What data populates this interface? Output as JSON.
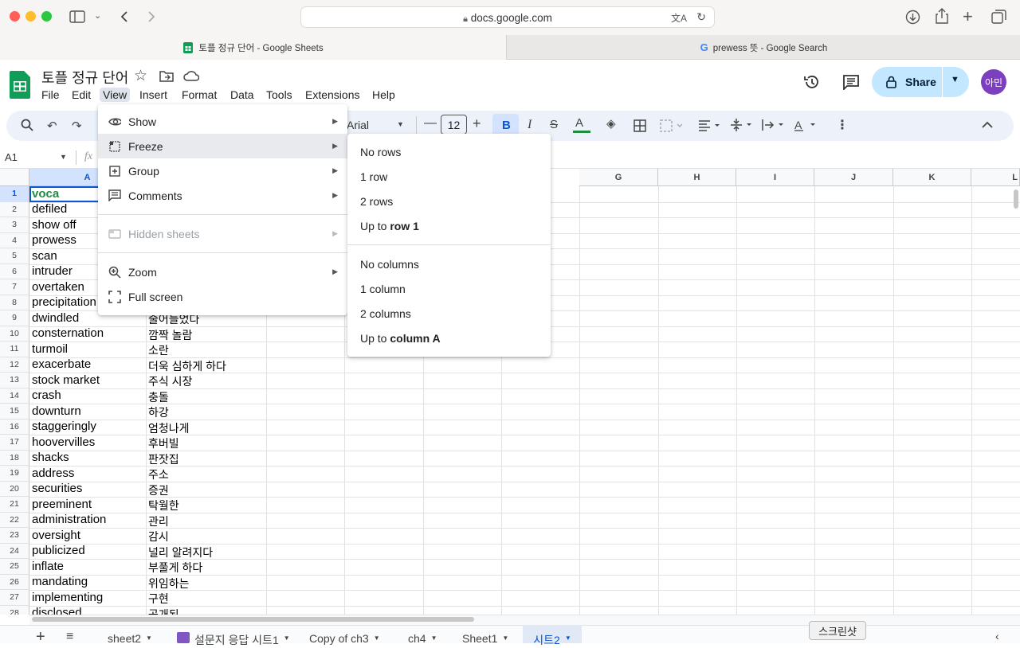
{
  "browser": {
    "url": "docs.google.com",
    "tabs": [
      {
        "title": "토플 정규 단어 - Google Sheets"
      },
      {
        "title": "prewess 뜻 - Google Search"
      }
    ]
  },
  "doc": {
    "title": "토플 정규 단어",
    "menus": [
      "File",
      "Edit",
      "View",
      "Insert",
      "Format",
      "Data",
      "Tools",
      "Extensions",
      "Help"
    ],
    "share_label": "Share",
    "avatar": "아민"
  },
  "toolbar": {
    "font": "Arial",
    "font_size": "12",
    "bold": "B",
    "italic": "I"
  },
  "formula": {
    "cell_ref": "A1",
    "fx": "fx"
  },
  "grid": {
    "columns": [
      "A",
      "G",
      "H",
      "I",
      "J",
      "K",
      "L"
    ],
    "rows": [
      {
        "n": "1",
        "a": "voca",
        "b": ""
      },
      {
        "n": "2",
        "a": "defiled",
        "b": ""
      },
      {
        "n": "3",
        "a": "show off",
        "b": ""
      },
      {
        "n": "4",
        "a": "prowess",
        "b": ""
      },
      {
        "n": "5",
        "a": "scan",
        "b": ""
      },
      {
        "n": "6",
        "a": "intruder",
        "b": ""
      },
      {
        "n": "7",
        "a": "overtaken",
        "b": ""
      },
      {
        "n": "8",
        "a": "precipitation",
        "b": ""
      },
      {
        "n": "9",
        "a": "dwindled",
        "b": "줄어들었다"
      },
      {
        "n": "10",
        "a": "consternation",
        "b": "깜짝 놀람"
      },
      {
        "n": "11",
        "a": "turmoil",
        "b": "소란"
      },
      {
        "n": "12",
        "a": "exacerbate",
        "b": "더욱 심하게 하다"
      },
      {
        "n": "13",
        "a": "stock market",
        "b": "주식 시장"
      },
      {
        "n": "14",
        "a": "crash",
        "b": "충돌"
      },
      {
        "n": "15",
        "a": "downturn",
        "b": "하강"
      },
      {
        "n": "16",
        "a": "staggeringly",
        "b": "엄청나게"
      },
      {
        "n": "17",
        "a": "hoovervilles",
        "b": "후버빌"
      },
      {
        "n": "18",
        "a": "shacks",
        "b": "판잣집"
      },
      {
        "n": "19",
        "a": "address",
        "b": "주소"
      },
      {
        "n": "20",
        "a": "securities",
        "b": "증권"
      },
      {
        "n": "21",
        "a": "preeminent",
        "b": "탁월한"
      },
      {
        "n": "22",
        "a": "administration",
        "b": "관리"
      },
      {
        "n": "23",
        "a": "oversight",
        "b": "감시"
      },
      {
        "n": "24",
        "a": "publicized",
        "b": "널리 알려지다"
      },
      {
        "n": "25",
        "a": "inflate",
        "b": "부풀게 하다"
      },
      {
        "n": "26",
        "a": "mandating",
        "b": "위임하는"
      },
      {
        "n": "27",
        "a": "implementing",
        "b": "구현"
      },
      {
        "n": "28",
        "a": "disclosed",
        "b": "공개된"
      }
    ]
  },
  "view_menu": {
    "items": [
      {
        "label": "Show",
        "icon": "eye-icon"
      },
      {
        "label": "Freeze",
        "icon": "freeze-grid-icon"
      },
      {
        "label": "Group",
        "icon": "group-plus-icon"
      },
      {
        "label": "Comments",
        "icon": "comment-icon"
      },
      {
        "label": "Hidden sheets",
        "icon": "hidden-sheet-icon"
      },
      {
        "label": "Zoom",
        "icon": "zoom-icon"
      },
      {
        "label": "Full screen",
        "icon": "fullscreen-icon"
      }
    ]
  },
  "freeze_menu": {
    "no_rows": "No rows",
    "one_row": "1 row",
    "two_rows": "2 rows",
    "up_to_row_prefix": "Up to ",
    "up_to_row_bold": "row 1",
    "no_columns": "No columns",
    "one_column": "1 column",
    "two_columns": "2 columns",
    "up_to_col_prefix": "Up to ",
    "up_to_col_bold": "column A"
  },
  "sheets": [
    "sheet2",
    "설문지 응답 시트1",
    "Copy of ch3",
    "ch4",
    "Sheet1",
    "시트2"
  ],
  "tooltip": "스크린샷",
  "colors": {
    "accent": "#0b57d0",
    "green": "#0f9d58",
    "voca": "#1e8e3e"
  }
}
